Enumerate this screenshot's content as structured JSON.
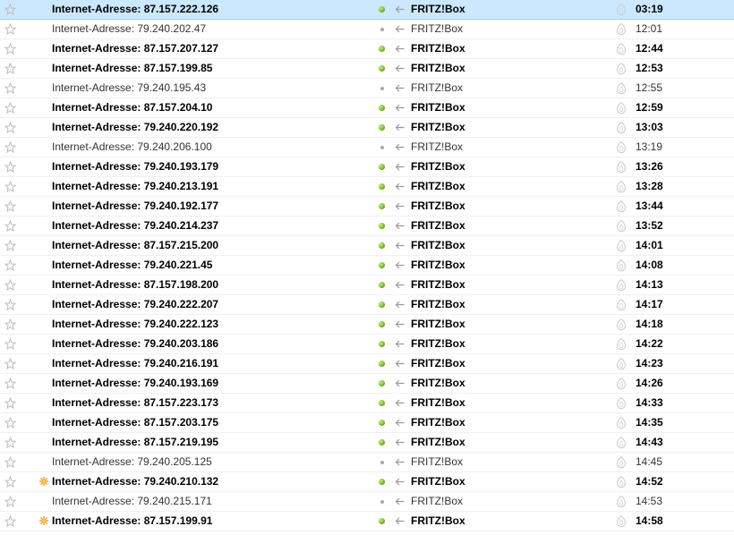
{
  "messages": [
    {
      "subject": "Internet-Adresse: 87.157.222.126",
      "sender": "FRITZ!Box",
      "date": "03:19",
      "unread": true,
      "selected": true,
      "junk": false
    },
    {
      "subject": "Internet-Adresse: 79.240.202.47",
      "sender": "FRITZ!Box",
      "date": "12:01",
      "unread": false,
      "selected": false,
      "junk": false
    },
    {
      "subject": "Internet-Adresse: 87.157.207.127",
      "sender": "FRITZ!Box",
      "date": "12:44",
      "unread": true,
      "selected": false,
      "junk": false
    },
    {
      "subject": "Internet-Adresse: 87.157.199.85",
      "sender": "FRITZ!Box",
      "date": "12:53",
      "unread": true,
      "selected": false,
      "junk": false
    },
    {
      "subject": "Internet-Adresse: 79.240.195.43",
      "sender": "FRITZ!Box",
      "date": "12:55",
      "unread": false,
      "selected": false,
      "junk": false
    },
    {
      "subject": "Internet-Adresse: 87.157.204.10",
      "sender": "FRITZ!Box",
      "date": "12:59",
      "unread": true,
      "selected": false,
      "junk": false
    },
    {
      "subject": "Internet-Adresse: 79.240.220.192",
      "sender": "FRITZ!Box",
      "date": "13:03",
      "unread": true,
      "selected": false,
      "junk": false
    },
    {
      "subject": "Internet-Adresse: 79.240.206.100",
      "sender": "FRITZ!Box",
      "date": "13:19",
      "unread": false,
      "selected": false,
      "junk": false
    },
    {
      "subject": "Internet-Adresse: 79.240.193.179",
      "sender": "FRITZ!Box",
      "date": "13:26",
      "unread": true,
      "selected": false,
      "junk": false
    },
    {
      "subject": "Internet-Adresse: 79.240.213.191",
      "sender": "FRITZ!Box",
      "date": "13:28",
      "unread": true,
      "selected": false,
      "junk": false
    },
    {
      "subject": "Internet-Adresse: 79.240.192.177",
      "sender": "FRITZ!Box",
      "date": "13:44",
      "unread": true,
      "selected": false,
      "junk": false
    },
    {
      "subject": "Internet-Adresse: 79.240.214.237",
      "sender": "FRITZ!Box",
      "date": "13:52",
      "unread": true,
      "selected": false,
      "junk": false
    },
    {
      "subject": "Internet-Adresse: 87.157.215.200",
      "sender": "FRITZ!Box",
      "date": "14:01",
      "unread": true,
      "selected": false,
      "junk": false
    },
    {
      "subject": "Internet-Adresse: 79.240.221.45",
      "sender": "FRITZ!Box",
      "date": "14:08",
      "unread": true,
      "selected": false,
      "junk": false
    },
    {
      "subject": "Internet-Adresse: 87.157.198.200",
      "sender": "FRITZ!Box",
      "date": "14:13",
      "unread": true,
      "selected": false,
      "junk": false
    },
    {
      "subject": "Internet-Adresse: 79.240.222.207",
      "sender": "FRITZ!Box",
      "date": "14:17",
      "unread": true,
      "selected": false,
      "junk": false
    },
    {
      "subject": "Internet-Adresse: 79.240.222.123",
      "sender": "FRITZ!Box",
      "date": "14:18",
      "unread": true,
      "selected": false,
      "junk": false
    },
    {
      "subject": "Internet-Adresse: 79.240.203.186",
      "sender": "FRITZ!Box",
      "date": "14:22",
      "unread": true,
      "selected": false,
      "junk": false
    },
    {
      "subject": "Internet-Adresse: 79.240.216.191",
      "sender": "FRITZ!Box",
      "date": "14:23",
      "unread": true,
      "selected": false,
      "junk": false
    },
    {
      "subject": "Internet-Adresse: 79.240.193.169",
      "sender": "FRITZ!Box",
      "date": "14:26",
      "unread": true,
      "selected": false,
      "junk": false
    },
    {
      "subject": "Internet-Adresse: 87.157.223.173",
      "sender": "FRITZ!Box",
      "date": "14:33",
      "unread": true,
      "selected": false,
      "junk": false
    },
    {
      "subject": "Internet-Adresse: 87.157.203.175",
      "sender": "FRITZ!Box",
      "date": "14:35",
      "unread": true,
      "selected": false,
      "junk": false
    },
    {
      "subject": "Internet-Adresse: 87.157.219.195",
      "sender": "FRITZ!Box",
      "date": "14:43",
      "unread": true,
      "selected": false,
      "junk": false
    },
    {
      "subject": "Internet-Adresse: 79.240.205.125",
      "sender": "FRITZ!Box",
      "date": "14:45",
      "unread": false,
      "selected": false,
      "junk": false
    },
    {
      "subject": "Internet-Adresse: 79.240.210.132",
      "sender": "FRITZ!Box",
      "date": "14:52",
      "unread": true,
      "selected": false,
      "junk": true
    },
    {
      "subject": "Internet-Adresse: 79.240.215.171",
      "sender": "FRITZ!Box",
      "date": "14:53",
      "unread": false,
      "selected": false,
      "junk": false
    },
    {
      "subject": "Internet-Adresse: 87.157.199.91",
      "sender": "FRITZ!Box",
      "date": "14:58",
      "unread": true,
      "selected": false,
      "junk": true
    }
  ],
  "icons": {
    "star": "star-icon",
    "junk": "new-sparkle-icon",
    "status_dot": "unread-status-dot-icon",
    "reply_arrow": "reply-arrow-icon",
    "flame": "junk-status-icon"
  },
  "colors": {
    "selected_bg": "#cce8ff",
    "unread_dot": "#5fae14",
    "read_dot": "#a7a7a7"
  }
}
